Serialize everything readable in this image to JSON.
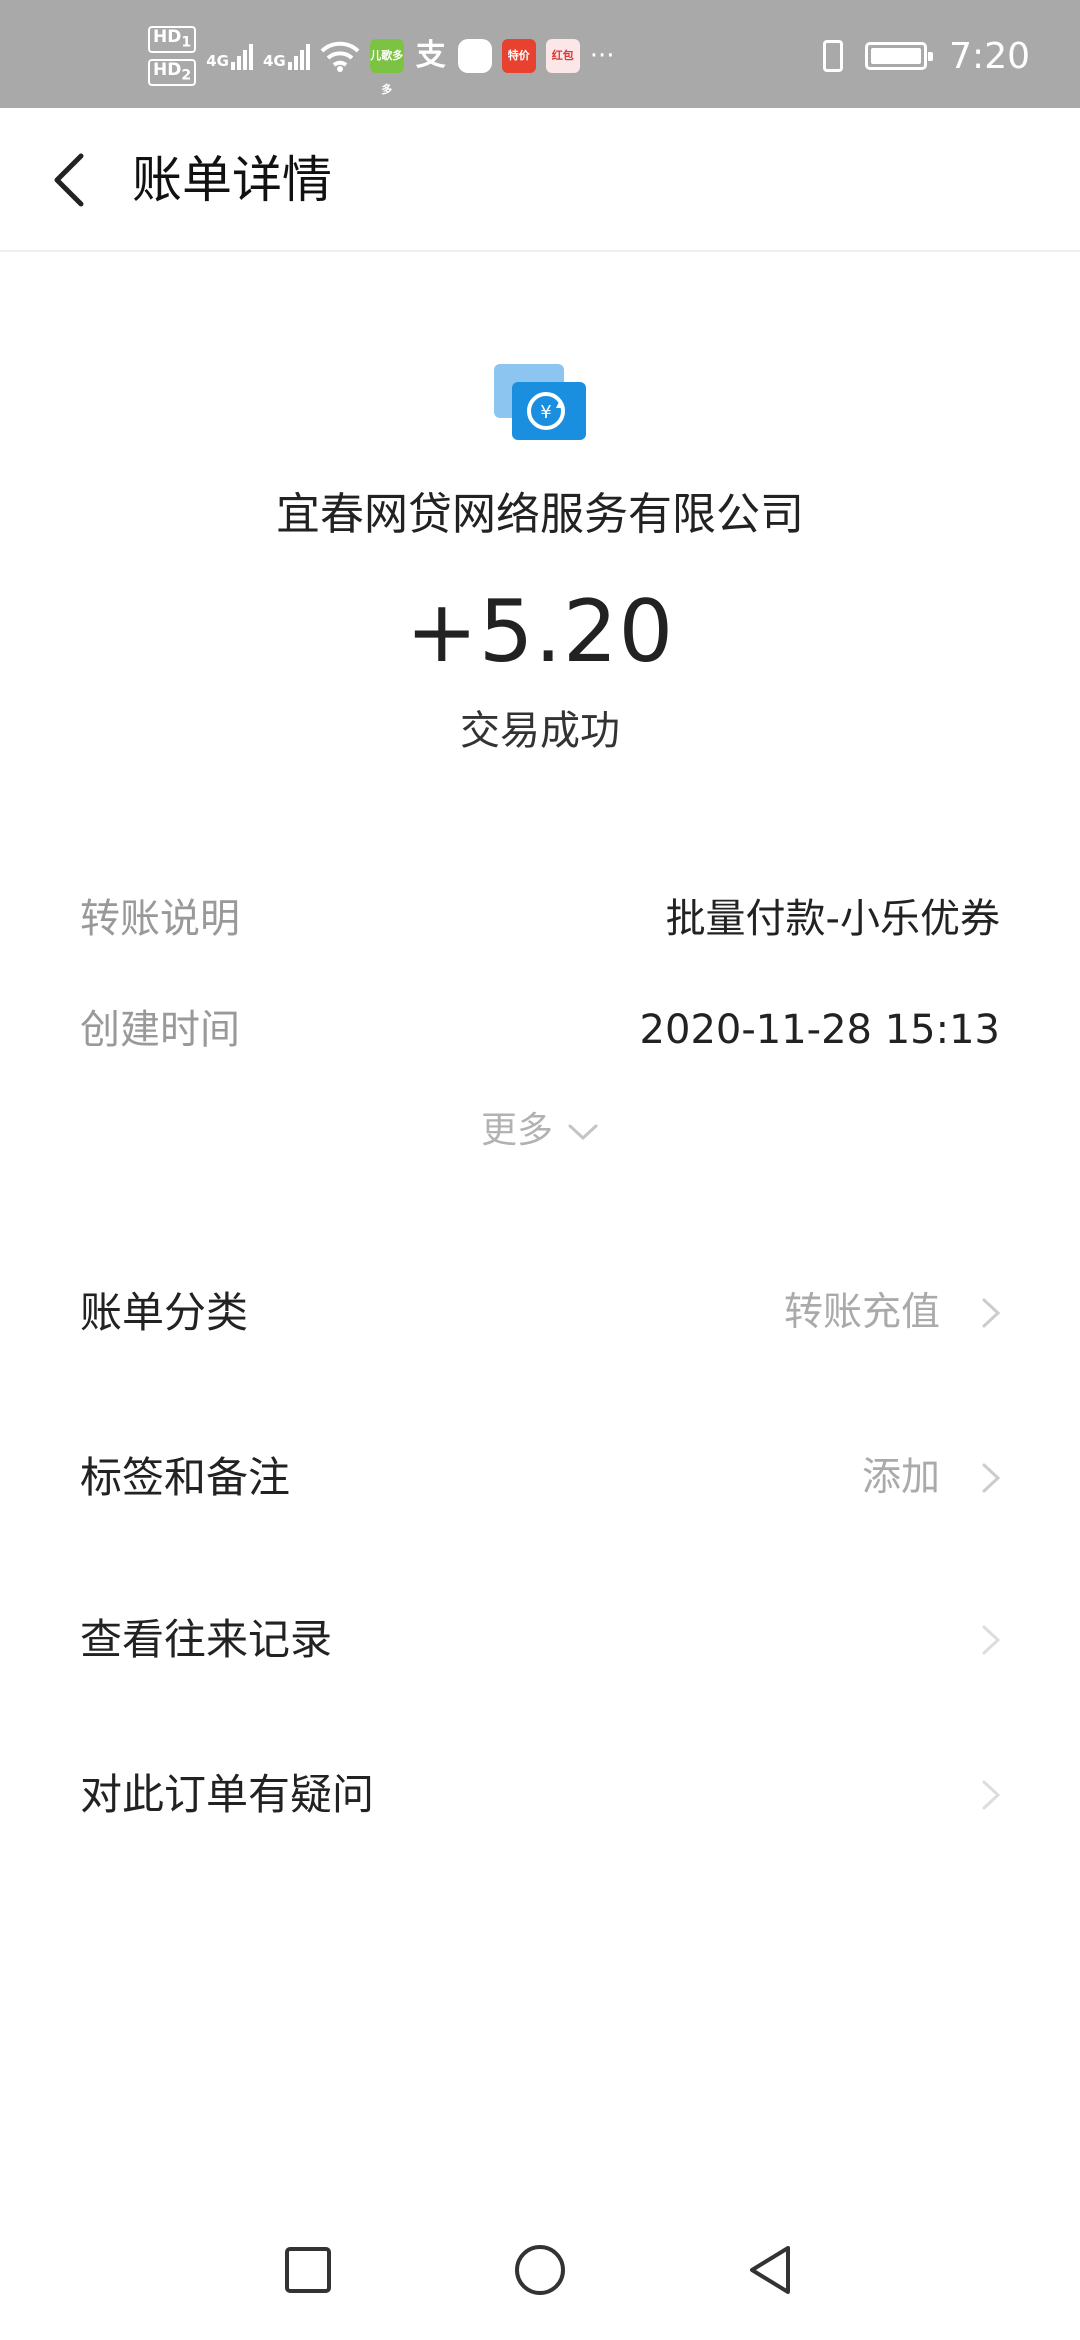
{
  "status_bar": {
    "left_badges": [
      "HD",
      "HD"
    ],
    "sim_slots": [
      "1",
      "2"
    ],
    "network_labels": [
      "4G",
      "4G"
    ],
    "app_icons": [
      {
        "name": "kids-app-icon",
        "label": "儿歌多多",
        "color": "#7cc243"
      },
      {
        "name": "alipay-icon",
        "label": "支",
        "color": "#ffffff"
      },
      {
        "name": "chat-app-icon",
        "label": "",
        "color": "#ffffff"
      },
      {
        "name": "shopping-app-icon",
        "label": "特价",
        "color": "#e8412f"
      },
      {
        "name": "gift-app-icon",
        "label": "红包",
        "color": "#d9383a"
      }
    ],
    "overflow": "···",
    "time": "7:20"
  },
  "header": {
    "title": "账单详情"
  },
  "hero": {
    "merchant_name": "宜春网贷网络服务有限公司",
    "amount": "+5.20",
    "status": "交易成功",
    "icon": "transfer-icon",
    "icon_color": "#1a8fe0"
  },
  "details": [
    {
      "label": "转账说明",
      "value": "批量付款-小乐优券"
    },
    {
      "label": "创建时间",
      "value": "2020-11-28 15:13"
    }
  ],
  "more_label": "更多",
  "actions": [
    {
      "label": "账单分类",
      "value": "转账充值"
    },
    {
      "label": "标签和备注",
      "value": "添加"
    },
    {
      "label": "查看往来记录",
      "value": ""
    },
    {
      "label": "对此订单有疑问",
      "value": ""
    }
  ],
  "colors": {
    "status_bar_bg": "#a9a9a9",
    "label_grey": "#999999",
    "accent_blue": "#1a8fe0"
  }
}
